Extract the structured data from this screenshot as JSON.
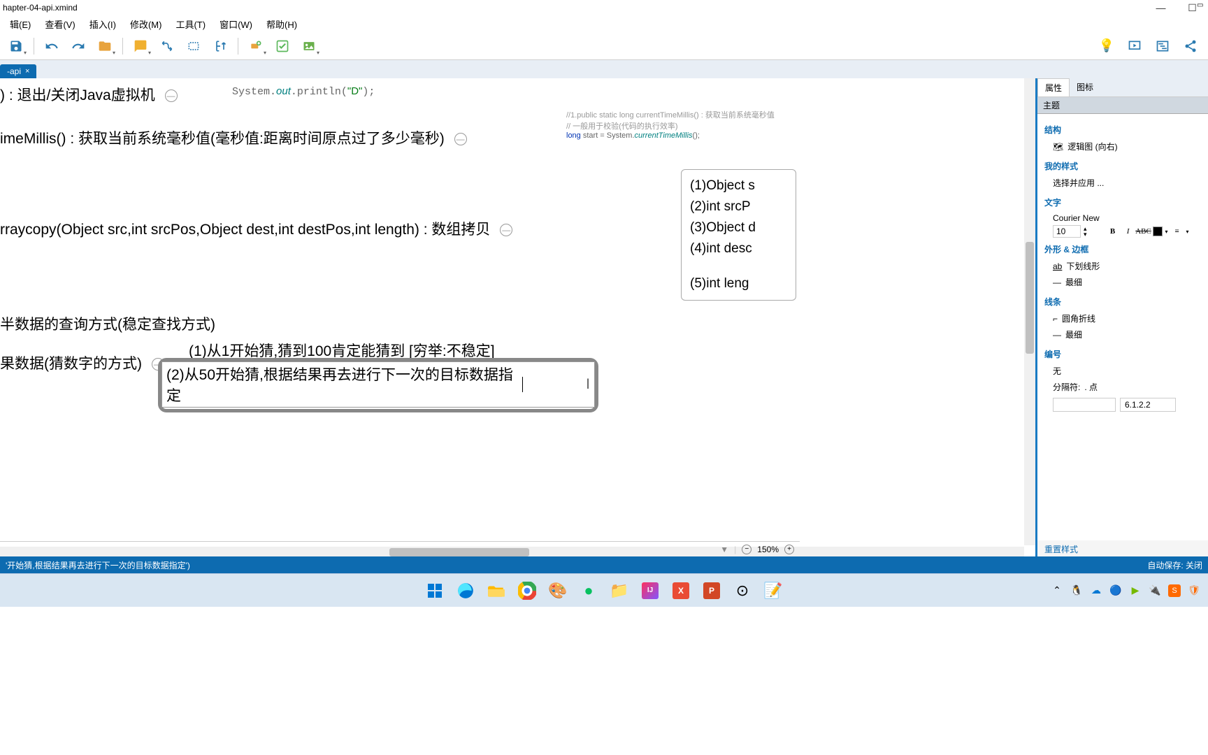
{
  "title": "hapter-04-api.xmind",
  "menu": {
    "items": [
      "辑(E)",
      "查看(V)",
      "插入(I)",
      "修改(M)",
      "工具(T)",
      "窗口(W)",
      "帮助(H)"
    ]
  },
  "tab": {
    "name": "-api",
    "close": "×"
  },
  "canvas": {
    "n1": ") : 退出/关闭Java虚拟机",
    "code_d": "System.out.println(\"D\");",
    "n2": "imeMillis() : 获取当前系统毫秒值(毫秒值:距离时间原点过了多少毫秒)",
    "cmt1": "//1.public static long currentTimeMillis() : 获取当前系统毫秒值",
    "cmt2": "// 一般用于校验(代码的执行效率)",
    "code_start": "long start = System.currentTimeMillis();",
    "n3": "rraycopy(Object src,int srcPos,Object dest,int destPos,int length) : 数组拷贝",
    "box": {
      "r1": "(1)Object s",
      "r2": "(2)int srcP",
      "r3": "(3)Object d",
      "r4": "(4)int desc",
      "r5": "(5)int leng"
    },
    "n4": "半数据的查询方式(稳定查找方式)",
    "n5": "果数据(猜数字的方式)",
    "n6": "(1)从1开始猜,猜到100肯定能猜到 [穷举:不稳定]",
    "editing": "(2)从50开始猜,根据结果再去进行下一次的目标数据指定"
  },
  "zoom": {
    "value": "150%"
  },
  "props": {
    "tab1": "属性",
    "tab2": "图标",
    "sub": "主题",
    "s_struct": "结构",
    "struct_val": "逻辑图 (向右)",
    "s_style": "我的样式",
    "style_val": "选择并应用 ...",
    "s_text": "文字",
    "font": "Courier New",
    "size": "10",
    "s_shape": "外形 & 边框",
    "underline": "下划线形",
    "thin1": "最细",
    "s_line": "线条",
    "rounded": "圆角折线",
    "thin2": "最细",
    "s_num": "编号",
    "none": "无",
    "sep_label": "分隔符:",
    "sep_val": ". 点",
    "prefix": "6.1.2.2",
    "reset": "重置样式"
  },
  "status": {
    "left": "'开始猜,根据结果再去进行下一次的目标数据指定')",
    "right": "自动保存: 关闭"
  }
}
